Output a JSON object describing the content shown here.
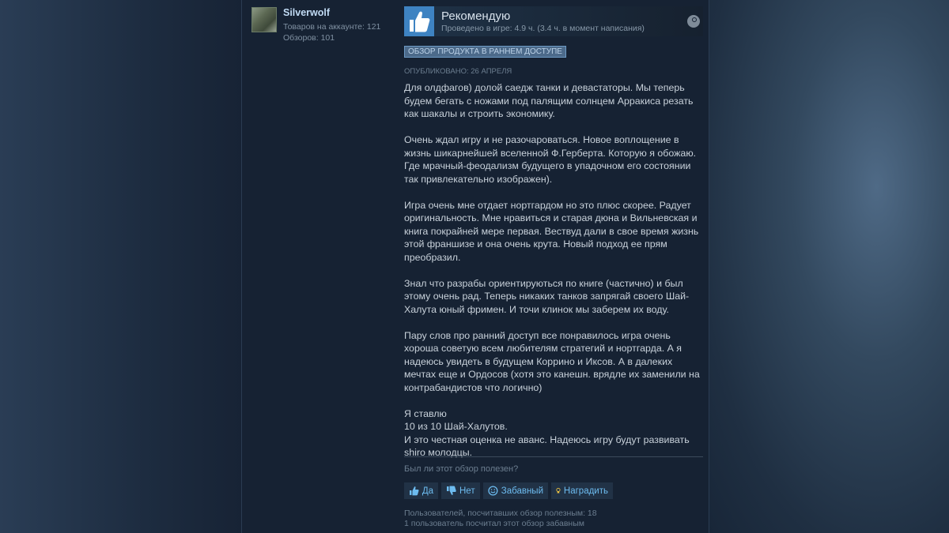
{
  "author": {
    "name": "Silverwolf",
    "products_label": "Товаров на аккаунте: 121",
    "reviews_label": "Обзоров: 101"
  },
  "review": {
    "verdict": "Рекомендую",
    "hours": "Проведено в игре: 4.9 ч. (3.4 ч. в момент написания)",
    "early_access_badge": "ОБЗОР ПРОДУКТА В РАННЕМ ДОСТУПЕ",
    "posted": "ОПУБЛИКОВАНО: 26 АПРЕЛЯ",
    "paragraphs": [
      "Для олдфагов) долой саедж танки и девастаторы. Мы теперь будем бегать с ножами под палящим солнцем Арракиса резать как шакалы и строить экономику.",
      "Очень ждал игру и не разочароваться. Новое воплощение в жизнь шикарнейшей вселенной Ф.Герберта. Которую я обожаю. Где мрачный-феодализм будущего в упадочном его состоянии так привлекательно изображен).",
      "Игра очень мне отдает нортгардом но это плюс скорее. Радует оригинальность. Мне нравиться и старая дюна и Вильневская и книга покрайней мере первая. Вествуд дали в свое время жизнь этой франшизе и она очень крута. Новый подход ее прям преобразил.",
      "Знал что разрабы ориентируються по книге (частично) и был этому очень рад. Теперь никаких танков запрягай своего Шай-Халута юный фримен. И точи клинок мы заберем их воду.",
      "Пару слов про ранний доступ все понравилось игра очень хороша советую всем любителям стратегий и нортгарда. А я надеюсь увидеть в будущем Коррино и Иксов. А в далеких мечтах еще и Ордосов (хотя это канешн. врядле их заменили на контрабандистов что логично)"
    ],
    "closing": [
      "Я ставлю",
      "10 из 10 Шай-Халутов.",
      "И это честная оценка не аванс. Надеюсь игру будут развивать",
      "shiro молодцы."
    ]
  },
  "helpful": {
    "question": "Был ли этот обзор полезен?",
    "yes_label": "Да",
    "no_label": "Нет",
    "funny_label": "Забавный",
    "award_label": "Наградить",
    "helpful_count_text": "Пользователей, посчитавших обзор полезным: 18",
    "funny_count_text": "1 пользователь посчитал этот обзор забавным"
  },
  "colors": {
    "accent": "#3e83c2",
    "link": "#6dbcf0",
    "award": "#f0c543"
  }
}
